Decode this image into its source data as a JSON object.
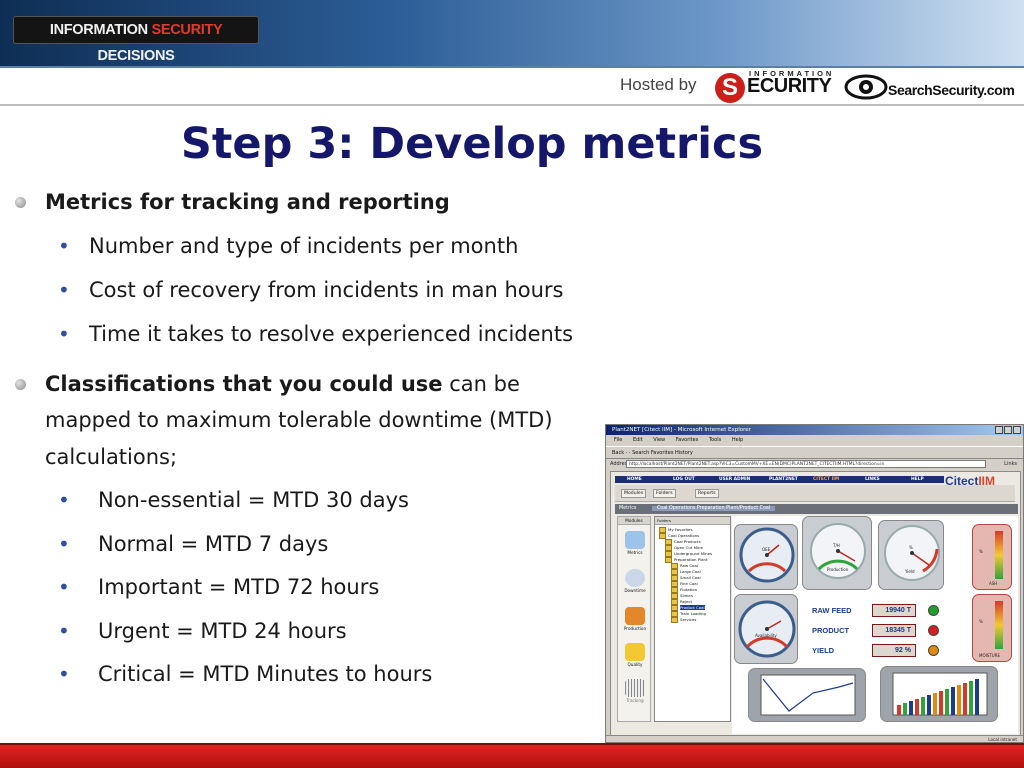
{
  "header": {
    "brand_part1": "INFORMATION ",
    "brand_part2": "SECURITY",
    "brand_part3": " DECISIONS",
    "hosted_by": "Hosted by",
    "is_logo_top": "INFORMATION",
    "is_logo_s": "S",
    "is_logo_rest": "ECURITY",
    "ss_logo": "SearchSecurity.com"
  },
  "slide": {
    "title": "Step 3: Develop metrics",
    "bullet1": {
      "text": "Metrics for tracking and reporting",
      "subs": [
        "Number and type of incidents per month",
        "Cost of recovery from incidents in man hours",
        "Time it takes to resolve experienced incidents"
      ]
    },
    "bullet2": {
      "bold": "Classifications that you could use",
      "rest_line1": " can be",
      "line2": "mapped to maximum tolerable downtime (MTD)",
      "line3": "calculations;",
      "subs": [
        "Non-essential = MTD 30 days",
        "Normal = MTD 7 days",
        "Important = MTD 72 hours",
        "Urgent = MTD 24 hours",
        "Critical = MTD Minutes to hours"
      ]
    }
  },
  "screenshot": {
    "window_title": "Plant2NET [Citect IIM] - Microsoft Internet Explorer",
    "menu": [
      "File",
      "Edit",
      "View",
      "Favorites",
      "Tools",
      "Help"
    ],
    "toolbar": "Back  ·  ·  Search  Favorites  History",
    "address_label": "Address",
    "address_url": "http://localhost/Plant2NET/Plant2NET.asp?VIC3=CustomMV+XE=EN(DMC)PLANT2NET_CITECTIIM.HTML?direction=in",
    "go": "Links",
    "nav": [
      "HOME",
      "LOG OUT",
      "USER ADMIN",
      "PLANT2NET",
      "CITECT IIM",
      "LINKS",
      "HELP"
    ],
    "brand_main": "Citect",
    "brand_em": "IIM",
    "sub_toolbar": [
      "Modules",
      "Folders",
      "Reports"
    ],
    "crumb_left": "Metrics",
    "crumb_right": "Coal Operations Preparation Plant/Product Coal",
    "modules_header": "Modules",
    "modules": [
      "Metrics",
      "Downtime",
      "Production",
      "Quality",
      "Tracking"
    ],
    "folders_header": "Folders",
    "folders": [
      "My Favorites",
      "Coal Operations",
      "Coal Products",
      "Open Cut Mine",
      "Underground Mines",
      "Preparation Plant",
      "Raw Coal",
      "Large Coal",
      "Small Coal",
      "Fine Coal",
      "Flotation",
      "Slimes",
      "Reject",
      "Product Coal",
      "Train Loading",
      "Services"
    ],
    "gauge_labels": {
      "oee": "OEE",
      "production": "Production",
      "tph": "T/H",
      "yield": "Yield",
      "availability": "Availability",
      "ash": "ASH",
      "moisture": "MOISTURE",
      "pct": "%"
    },
    "kpis": [
      {
        "label": "RAW FEED",
        "value": "19940 T",
        "status_color": "#1fa02a"
      },
      {
        "label": "PRODUCT",
        "value": "18345 T",
        "status_color": "#d42020"
      },
      {
        "label": "YIELD",
        "value": "92 %",
        "status_color": "#e08a10"
      }
    ],
    "status_right": "Local intranet"
  }
}
